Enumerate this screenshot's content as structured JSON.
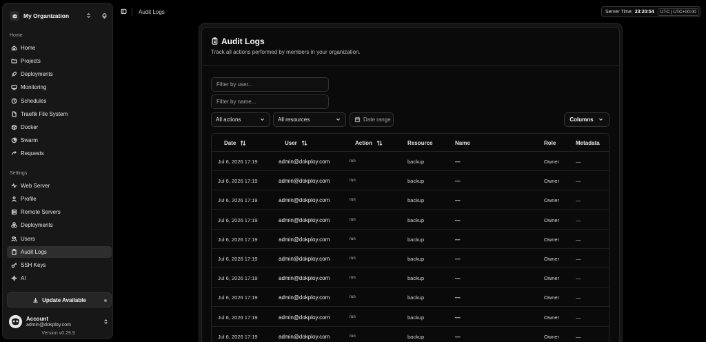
{
  "org": {
    "name": "My Organization"
  },
  "sidebar": {
    "home_label": "Home",
    "settings_label": "Settings",
    "home_items": [
      {
        "label": "Home",
        "icon": "home-icon"
      },
      {
        "label": "Projects",
        "icon": "folder-icon"
      },
      {
        "label": "Deployments",
        "icon": "rocket-icon"
      },
      {
        "label": "Monitoring",
        "icon": "monitor-icon"
      },
      {
        "label": "Schedules",
        "icon": "clock-icon"
      },
      {
        "label": "Traefik File System",
        "icon": "file-icon"
      },
      {
        "label": "Docker",
        "icon": "box-icon"
      },
      {
        "label": "Swarm",
        "icon": "pie-icon"
      },
      {
        "label": "Requests",
        "icon": "arrow-icon"
      }
    ],
    "settings_items": [
      {
        "label": "Web Server",
        "icon": "activity-icon"
      },
      {
        "label": "Profile",
        "icon": "user-icon"
      },
      {
        "label": "Remote Servers",
        "icon": "server-icon"
      },
      {
        "label": "Deployments",
        "icon": "boxes-icon"
      },
      {
        "label": "Users",
        "icon": "users-icon"
      },
      {
        "label": "Audit Logs",
        "icon": "clipboard-icon",
        "active": true
      },
      {
        "label": "SSH Keys",
        "icon": "key-icon"
      },
      {
        "label": "AI",
        "icon": "sparkle-icon"
      }
    ],
    "update_label": "Update Available",
    "account": {
      "name": "Account",
      "email": "admin@dokploy.com"
    },
    "version": "Version v0.29.9"
  },
  "topbar": {
    "breadcrumb": "Audit Logs",
    "server_time_label": "Server Time:",
    "server_time_value": "23:20:54",
    "timezone": "UTC | UTC+00:00"
  },
  "page": {
    "title": "Audit Logs",
    "subtitle": "Track all actions performed by members in your organization.",
    "filter_user_placeholder": "Filter by user...",
    "filter_name_placeholder": "Filter by name...",
    "actions_select": "All actions",
    "resources_select": "All resources",
    "date_range_label": "Date range",
    "columns_label": "Columns"
  },
  "table": {
    "headers": {
      "date": "Date",
      "user": "User",
      "action": "Action",
      "resource": "Resource",
      "name": "Name",
      "role": "Role",
      "metadata": "Metadata"
    },
    "rows": [
      {
        "date": "Jul 6, 2026 17:19",
        "user": "admin@dokploy.com",
        "action": "run",
        "resource": "backup",
        "name": "—",
        "role": "Owner",
        "metadata": "—"
      },
      {
        "date": "Jul 6, 2026 17:19",
        "user": "admin@dokploy.com",
        "action": "run",
        "resource": "backup",
        "name": "—",
        "role": "Owner",
        "metadata": "—"
      },
      {
        "date": "Jul 6, 2026 17:19",
        "user": "admin@dokploy.com",
        "action": "run",
        "resource": "backup",
        "name": "—",
        "role": "Owner",
        "metadata": "—"
      },
      {
        "date": "Jul 6, 2026 17:19",
        "user": "admin@dokploy.com",
        "action": "run",
        "resource": "backup",
        "name": "—",
        "role": "Owner",
        "metadata": "—"
      },
      {
        "date": "Jul 6, 2026 17:19",
        "user": "admin@dokploy.com",
        "action": "run",
        "resource": "backup",
        "name": "—",
        "role": "Owner",
        "metadata": "—"
      },
      {
        "date": "Jul 6, 2026 17:19",
        "user": "admin@dokploy.com",
        "action": "run",
        "resource": "backup",
        "name": "—",
        "role": "Owner",
        "metadata": "—"
      },
      {
        "date": "Jul 6, 2026 17:19",
        "user": "admin@dokploy.com",
        "action": "run",
        "resource": "backup",
        "name": "—",
        "role": "Owner",
        "metadata": "—"
      },
      {
        "date": "Jul 6, 2026 17:19",
        "user": "admin@dokploy.com",
        "action": "run",
        "resource": "backup",
        "name": "—",
        "role": "Owner",
        "metadata": "—"
      },
      {
        "date": "Jul 6, 2026 17:19",
        "user": "admin@dokploy.com",
        "action": "run",
        "resource": "backup",
        "name": "—",
        "role": "Owner",
        "metadata": "—"
      },
      {
        "date": "Jul 6, 2026 17:19",
        "user": "admin@dokploy.com",
        "action": "run",
        "resource": "backup",
        "name": "—",
        "role": "Owner",
        "metadata": "—"
      }
    ]
  }
}
